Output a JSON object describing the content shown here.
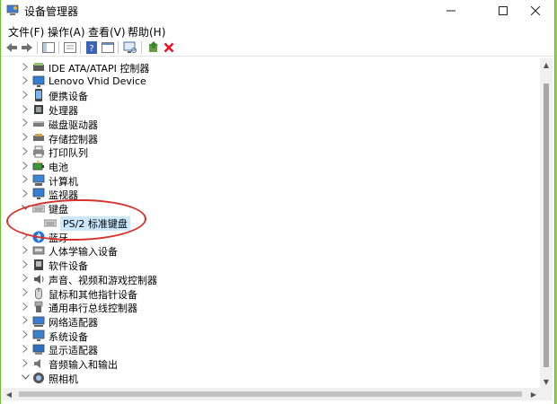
{
  "title": "设备管理器",
  "menu": [
    "文件(F)",
    "操作(A)",
    "查看(V)",
    "帮助(H)"
  ],
  "tree": [
    {
      "label": "IDE ATA/ATAPI 控制器",
      "icon": "ide-controller-icon",
      "expanded": false
    },
    {
      "label": "Lenovo Vhid Device",
      "icon": "monitor-icon",
      "expanded": false
    },
    {
      "label": "便携设备",
      "icon": "portable-device-icon",
      "expanded": false
    },
    {
      "label": "处理器",
      "icon": "processor-icon",
      "expanded": false
    },
    {
      "label": "磁盘驱动器",
      "icon": "disk-drive-icon",
      "expanded": false
    },
    {
      "label": "存储控制器",
      "icon": "storage-controller-icon",
      "expanded": false
    },
    {
      "label": "打印队列",
      "icon": "printer-icon",
      "expanded": false
    },
    {
      "label": "电池",
      "icon": "battery-icon",
      "expanded": false
    },
    {
      "label": "计算机",
      "icon": "computer-icon",
      "expanded": false
    },
    {
      "label": "监视器",
      "icon": "monitor-icon",
      "expanded": false
    },
    {
      "label": "键盘",
      "icon": "keyboard-icon",
      "expanded": true
    },
    {
      "label": "PS/2 标准键盘",
      "icon": "keyboard-icon",
      "child": true,
      "selected": true
    },
    {
      "label": "蓝牙",
      "icon": "bluetooth-icon",
      "expanded": false
    },
    {
      "label": "人体学输入设备",
      "icon": "hid-icon",
      "expanded": false
    },
    {
      "label": "软件设备",
      "icon": "software-device-icon",
      "expanded": false
    },
    {
      "label": "声音、视频和游戏控制器",
      "icon": "speaker-icon",
      "expanded": false
    },
    {
      "label": "鼠标和其他指针设备",
      "icon": "mouse-icon",
      "expanded": false
    },
    {
      "label": "通用串行总线控制器",
      "icon": "usb-icon",
      "expanded": false
    },
    {
      "label": "网络适配器",
      "icon": "network-adapter-icon",
      "expanded": false
    },
    {
      "label": "系统设备",
      "icon": "system-device-icon",
      "expanded": false
    },
    {
      "label": "显示适配器",
      "icon": "display-adapter-icon",
      "expanded": false
    },
    {
      "label": "音频输入和输出",
      "icon": "audio-io-icon",
      "expanded": false
    },
    {
      "label": "照相机",
      "icon": "camera-icon",
      "expanded": true
    }
  ],
  "colors": {
    "highlight_circle": "#d9322e",
    "selection": "#cce8ff",
    "delete_icon": "#e81123"
  }
}
